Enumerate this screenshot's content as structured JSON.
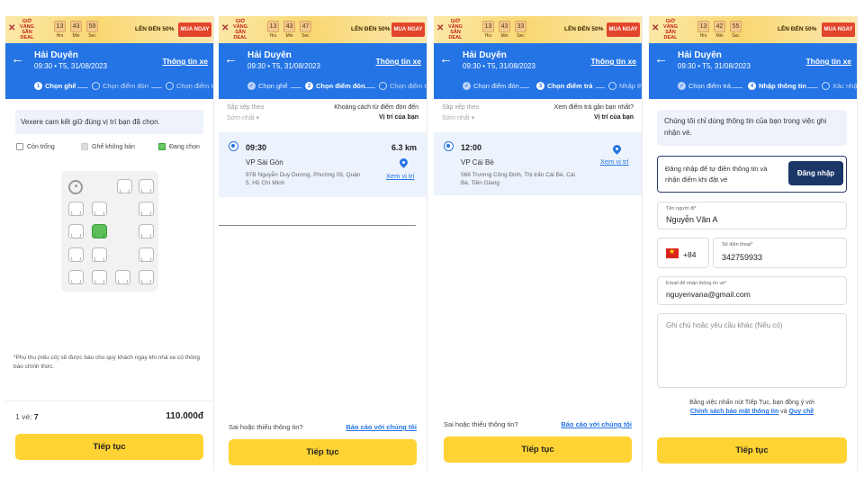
{
  "banner": {
    "logo_text": "GIỜ VÀNG SĂN DEAL",
    "promo": "LÊN ĐẾN 50%",
    "buy_label": "MUA NGAY",
    "units": {
      "h": "Hrs",
      "m": "Min",
      "s": "Sec"
    },
    "p1": {
      "h": "13",
      "m": "43",
      "s": "59"
    },
    "p2": {
      "h": "13",
      "m": "43",
      "s": "47"
    },
    "p3": {
      "h": "13",
      "m": "43",
      "s": "33"
    },
    "p4": {
      "h": "13",
      "m": "42",
      "s": "55"
    }
  },
  "header": {
    "title": "Hải Duyên",
    "subtitle": "09:30 • T5, 31/08/2023",
    "info_link": "Thông tin xe"
  },
  "steps": {
    "p1": [
      "Chọn ghế",
      "Chọn điểm đón",
      "Chọn điểm trả"
    ],
    "p2": [
      "Chọn ghế",
      "Chọn điểm đón",
      "Chọn điểm trả"
    ],
    "p3": [
      "Chọn điểm đón",
      "Chọn điểm trả",
      "Nhập thông tin"
    ],
    "p4": [
      "Chọn điểm trả",
      "Nhập thông tin",
      "Xác nhận"
    ]
  },
  "seat_screen": {
    "notice": "Vexere cam kết giữ đúng vị trí bạn đã chọn.",
    "legend": [
      "Còn trống",
      "Ghế không bán",
      "Đang chọn"
    ],
    "footnote": "*Phụ thu (nếu có) sẽ được báo cho quý khách ngay khi nhà xe có thông báo chính thức.",
    "ticket_label": "1 vé:",
    "ticket_code": "7",
    "total": "110.000đ",
    "cta": "Tiếp tục"
  },
  "pickup_screen": {
    "sort_label": "Sắp xếp theo",
    "sort_value": "Sớm nhất",
    "hint": "Khoảng cách từ điểm đón đến",
    "location": "Vị trí của bạn",
    "time": "09:30",
    "distance": "6.3 km",
    "place": "VP Sài Gòn",
    "address": "97B Nguyễn Duy Dương, Phường 09, Quận 5, Hồ Chí Minh",
    "view_map": "Xem vị trí",
    "report_q": "Sai hoặc thiếu thông tin?",
    "report_a": "Báo cáo với chúng tôi",
    "cta": "Tiếp tục"
  },
  "dropoff_screen": {
    "sort_label": "Sắp xếp theo",
    "sort_value": "Sớm nhất",
    "hint": "Xem điểm trả gần bạn nhất?",
    "location": "Vị trí của bạn",
    "time": "12:00",
    "place": "VP Cái Bè",
    "address": "568 Trương Công Định, Thị trấn Cái Bè, Cái Bè, Tiền Giang",
    "view_map": "Xem vị trí",
    "report_q": "Sai hoặc thiếu thông tin?",
    "report_a": "Báo cáo với chúng tôi",
    "cta": "Tiếp tục"
  },
  "info_screen": {
    "note": "Chúng tôi chỉ dùng thông tin của bạn trong việc ghi nhận vé.",
    "login_text": "Đăng nhập để tự điền thông tin và nhận điểm khi đặt vé",
    "login_btn": "Đăng nhập",
    "name_label": "Tên người đi*",
    "name_value": "Nguyễn Văn A",
    "country_code": "+84",
    "phone_label": "Số điện thoại*",
    "phone_value": "342759933",
    "email_label": "Email để nhận thông tin vé*",
    "email_value": "nguyenvana@gmail.com",
    "note_placeholder": "Ghi chú hoặc yêu cầu khác (Nếu có)",
    "terms_prefix": "Bằng việc nhấn nút Tiếp Tục, bạn đồng ý với",
    "terms_link1": "Chính sách bảo mật thông tin",
    "terms_and": "và",
    "terms_link2": "Quy chế",
    "cta": "Tiếp tục"
  }
}
